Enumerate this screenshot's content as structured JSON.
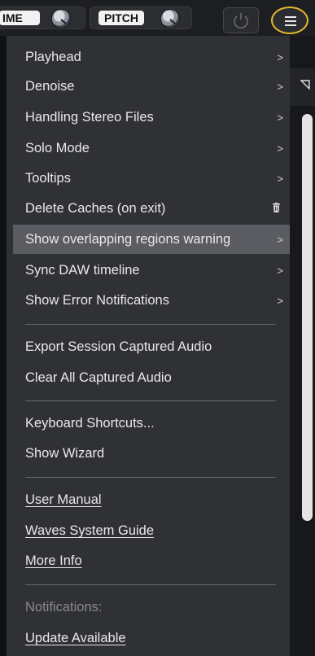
{
  "toolbar": {
    "time_label": "IME",
    "pitch_label": "PITCH"
  },
  "menu": {
    "group1": [
      {
        "label": "Playhead",
        "arrow": ">"
      },
      {
        "label": "Denoise",
        "arrow": ">"
      },
      {
        "label": "Handling Stereo Files",
        "arrow": ">"
      },
      {
        "label": "Solo Mode",
        "arrow": ">"
      },
      {
        "label": "Tooltips",
        "arrow": ">"
      },
      {
        "label": "Delete Caches (on exit)",
        "icon": "trash-icon"
      },
      {
        "label": "Show overlapping regions warning",
        "arrow": ">",
        "selected": true
      },
      {
        "label": "Sync DAW timeline",
        "arrow": ">"
      },
      {
        "label": "Show Error Notifications",
        "arrow": ">"
      }
    ],
    "group2": [
      {
        "label": "Export Session Captured Audio"
      },
      {
        "label": "Clear All Captured Audio"
      }
    ],
    "group3": [
      {
        "label": "Keyboard Shortcuts..."
      },
      {
        "label": "Show Wizard"
      }
    ],
    "group4": [
      {
        "label": "User Manual"
      },
      {
        "label": "Waves System Guide"
      },
      {
        "label": "More Info"
      }
    ],
    "notifications_header": "Notifications:",
    "update_link": "Update Available"
  },
  "colors": {
    "menu_bg": "#303135",
    "selected_bg": "#5b5c61",
    "highlight_ring": "#e6b82d"
  }
}
